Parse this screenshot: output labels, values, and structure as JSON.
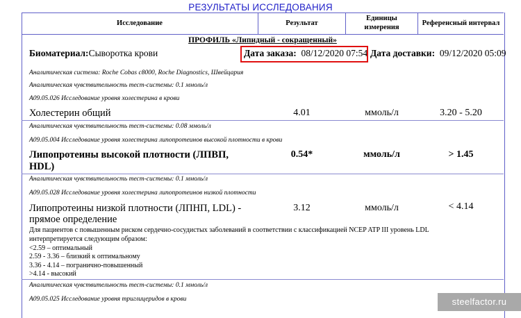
{
  "report_title": "РЕЗУЛЬТАТЫ ИССЛЕДОВАНИЯ",
  "headers": {
    "study": "Исследование",
    "result": "Результат",
    "units_line1": "Единицы",
    "units_line2": "измерения",
    "reference": "Референсный интервал"
  },
  "profile_title": "ПРОФИЛЬ «Липидный - сокращенный»",
  "biomaterial_label": "Биоматериал:",
  "biomaterial_value": "Сыворотка крови",
  "order_date_label": "Дата заказа:",
  "order_date_value": "08/12/2020 07:54",
  "delivery_date_label": "Дата доставки:",
  "delivery_date_value": "09/12/2020 05:09",
  "analytic_system": "Аналитическая система: Roche Cobas c8000, Roche Diagnostics, Швейцария",
  "tests": [
    {
      "sensitivity": "Аналитическая чувствительность тест-системы: 0.1 ммоль/л",
      "code": "A09.05.026 Исследование уровня холестерина в крови",
      "name": "Холестерин общий",
      "name_line2": "",
      "result": "4.01",
      "units": "ммоль/л",
      "reference": "3.20 - 5.20"
    },
    {
      "sensitivity": "Аналитическая чувствительность тест-системы: 0.08 ммоль/л",
      "code": "A09.05.004 Исследование уровня холестерина липопротеинов высокой плотности в крови",
      "name": "Липопротеины высокой плотности (ЛПВП,",
      "name_line2": "HDL)",
      "result": "0.54*",
      "units": "ммоль/л",
      "reference": "> 1.45"
    },
    {
      "sensitivity": "Аналитическая чувствительность тест-системы: 0.1 ммоль/л",
      "code": "A09.05.028 Исследование уровня холестерина липопротеинов низкой плотности",
      "name": "Липопротеины низкой плотности (ЛПНП, LDL) -",
      "name_line2": "прямое определение",
      "result": "3.12",
      "units": "ммоль/л",
      "reference": "< 4.14"
    },
    {
      "sensitivity": "Аналитическая чувствительность тест-системы: 0.1 ммоль/л",
      "code": "A09.05.025 Исследование уровня триглицеридов в крови"
    }
  ],
  "ldl_note": {
    "line1": "Для пациентов с повышенным риском сердечно-сосудистых заболеваний в соответствии с классификацией NCEP ATP III уровень LDL",
    "line2": "интерпретируется следующим образом:",
    "levels": [
      "<2.59 – оптимальный",
      "2.59 - 3.36 – близкий к оптимальному",
      "3.36 - 4.14 – погранично-повышенный",
      ">4.14 - высокий"
    ]
  },
  "watermark": "steelfactor.ru"
}
